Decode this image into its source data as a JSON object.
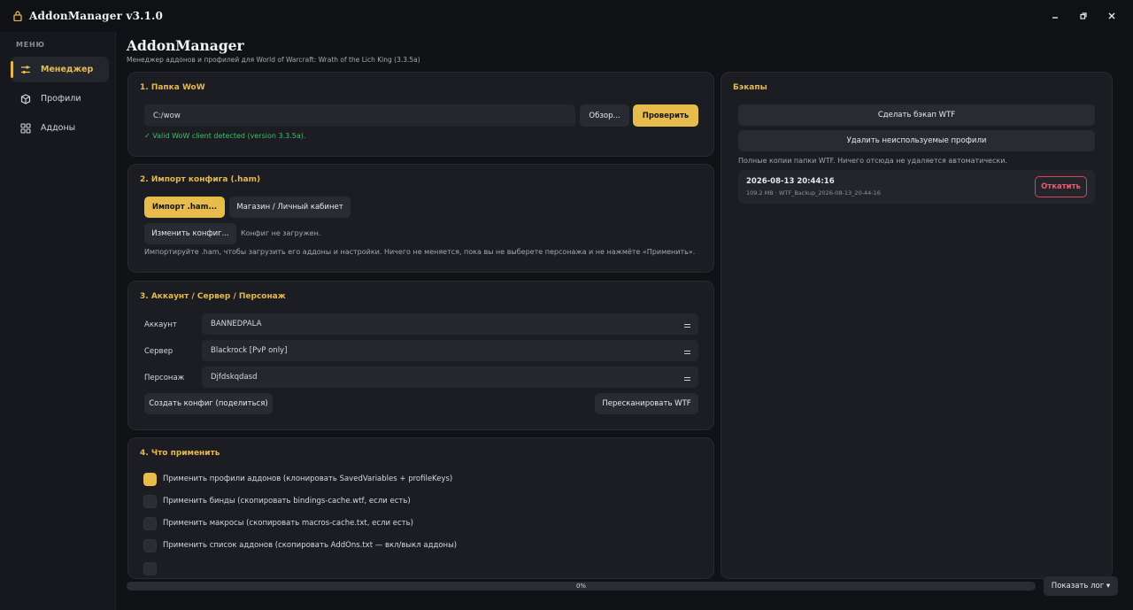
{
  "window": {
    "title": "AddonManager v3.1.0"
  },
  "sidebar": {
    "menu_label": "МЕНЮ",
    "items": [
      {
        "label": "Менеджер",
        "icon": "sliders-icon"
      },
      {
        "label": "Профили",
        "icon": "box-icon"
      },
      {
        "label": "Аддоны",
        "icon": "grid-icon"
      }
    ]
  },
  "header": {
    "title": "AddonManager",
    "subtitle": "Менеджер аддонов и профилей для World of Warcraft: Wrath of the Lich King (3.3.5a)"
  },
  "wow_folder": {
    "title": "1. Папка WoW",
    "path": "C:/wow",
    "browse_label": "Обзор...",
    "verify_label": "Проверить",
    "status": "✓ Valid WoW client detected (version 3.3.5a)."
  },
  "import": {
    "title": "2. Импорт конфига (.ham)",
    "import_label": "Импорт .ham...",
    "shop_label": "Магазин / Личный кабинет",
    "edit_label": "Изменить конфиг...",
    "status": "Конфиг не загружен.",
    "hint": "Импортируйте .ham, чтобы загрузить его аддоны и настройки. Ничего не меняется, пока вы не выберете персонажа и не нажмёте «Применить»."
  },
  "account": {
    "title": "3. Аккаунт / Сервер / Персонаж",
    "fields": [
      {
        "label": "Аккаунт",
        "value": "BANNEDPALA"
      },
      {
        "label": "Сервер",
        "value": "Blackrock [PvP only]"
      },
      {
        "label": "Персонаж",
        "value": "Djfdskqdasd"
      }
    ],
    "create_label": "Создать конфиг (поделиться)",
    "rescan_label": "Пересканировать WTF"
  },
  "apply": {
    "title": "4. Что применить",
    "options": [
      {
        "label": "Применить профили аддонов (клонировать SavedVariables + profileKeys)",
        "checked": true
      },
      {
        "label": "Применить бинды (скопировать bindings-cache.wtf, если есть)",
        "checked": false
      },
      {
        "label": "Применить макросы (скопировать macros-cache.txt, если есть)",
        "checked": false
      },
      {
        "label": "Применить список аддонов (скопировать AddOns.txt — вкл/выкл аддоны)",
        "checked": false
      }
    ]
  },
  "backups": {
    "title": "Бэкапы",
    "make_label": "Сделать бэкап WTF",
    "delete_label": "Удалить неиспользуемые профили",
    "note": "Полные копии папки WTF. Ничего отсюда не удаляется автоматически.",
    "items": [
      {
        "date": "2026-08-13 20:44:16",
        "meta": "109.2 MB · WTF_Backup_2026-08-13_20-44-16",
        "rollback_label": "Откатить"
      }
    ]
  },
  "footer": {
    "progress": 0,
    "progress_text": "0%",
    "log_label": "Показать лог ▾"
  },
  "colors": {
    "accent": "#e8bb4d",
    "danger": "#d4465a",
    "success": "#3fbf6a"
  }
}
